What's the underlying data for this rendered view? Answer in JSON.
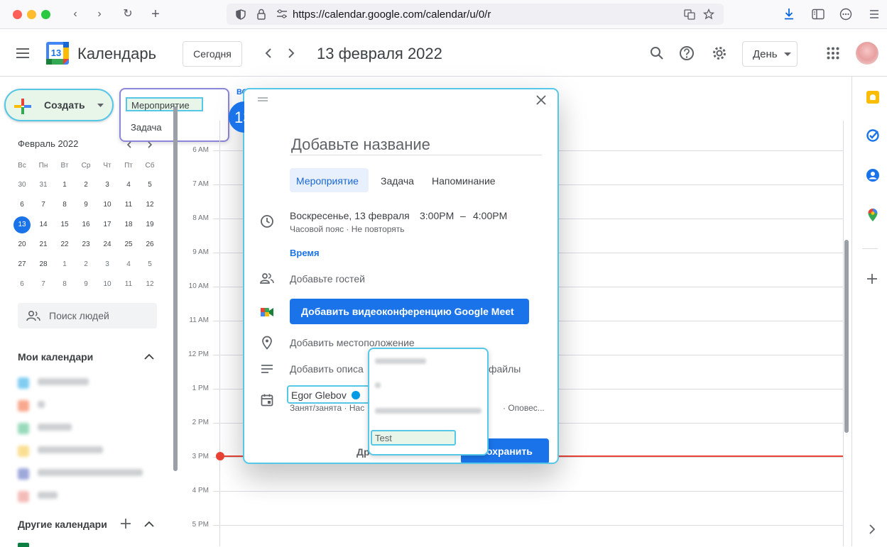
{
  "browser": {
    "url": "https://calendar.google.com/calendar/u/0/r",
    "icons": [
      "back-icon",
      "forward-icon",
      "reload-icon",
      "new-tab-icon",
      "shield-icon",
      "lock-icon",
      "permissions-icon",
      "translate-icon",
      "bookmark-star-icon",
      "download-icon",
      "sidebar-icon",
      "extensions-icon",
      "menu-icon"
    ]
  },
  "header": {
    "app_title": "Календарь",
    "logo_day": "13",
    "today_label": "Сегодня",
    "date_title": "13 февраля 2022",
    "view_select": "День"
  },
  "sidebar": {
    "create_label": "Создать",
    "mini_month": "Февраль 2022",
    "weekdays": [
      "Вс",
      "Пн",
      "Вт",
      "Ср",
      "Чт",
      "Пт",
      "Сб"
    ],
    "weeks": [
      [
        "30",
        "31",
        "1",
        "2",
        "3",
        "4",
        "5"
      ],
      [
        "6",
        "7",
        "8",
        "9",
        "10",
        "11",
        "12"
      ],
      [
        "13",
        "14",
        "15",
        "16",
        "17",
        "18",
        "19"
      ],
      [
        "20",
        "21",
        "22",
        "23",
        "24",
        "25",
        "26"
      ],
      [
        "27",
        "28",
        "1",
        "2",
        "3",
        "4",
        "5"
      ],
      [
        "6",
        "7",
        "8",
        "9",
        "10",
        "11",
        "12"
      ]
    ],
    "selected_day": "13",
    "people_search_placeholder": "Поиск людей",
    "my_calendars_title": "Мои календари",
    "other_calendars_title": "Другие календари",
    "calendar_colors": [
      "#039be5",
      "#f4511e",
      "#33b679",
      "#f6bf26",
      "#3f51b5",
      "#e67c73"
    ]
  },
  "create_menu": {
    "items": [
      "Мероприятие",
      "Задача"
    ]
  },
  "grid": {
    "day_abbrev": "ВС",
    "hours": [
      "6 AM",
      "7 AM",
      "8 AM",
      "9 AM",
      "10 AM",
      "11 AM",
      "12 PM",
      "1 PM",
      "2 PM",
      "3 PM",
      "4 PM",
      "5 PM"
    ],
    "current_time_color": "#ea4335"
  },
  "dialog": {
    "title_placeholder": "Добавьте название",
    "tabs": [
      "Мероприятие",
      "Задача",
      "Напоминание"
    ],
    "date_text": "Воскресенье, 13 февраля",
    "start_time": "3:00PM",
    "dash": "–",
    "end_time": "4:00PM",
    "tz_repeat": "Часовой пояс · Не повторять",
    "time_link": "Время",
    "add_guests": "Добавьте гостей",
    "meet_button": "Добавить видеоконференцию Google Meet",
    "add_location": "Добавить местоположение",
    "add_description": "Добавить описа",
    "add_description_tail": "файлы",
    "calendar_owner": "Egor Glebov",
    "busy_status": "Занят/занята · Нас",
    "notify_tail": "· Оповес...",
    "more_options": "Др",
    "save_label": "охранить",
    "accent": "#1a73e8"
  },
  "calendar_popup": {
    "selected_input": "Test"
  }
}
